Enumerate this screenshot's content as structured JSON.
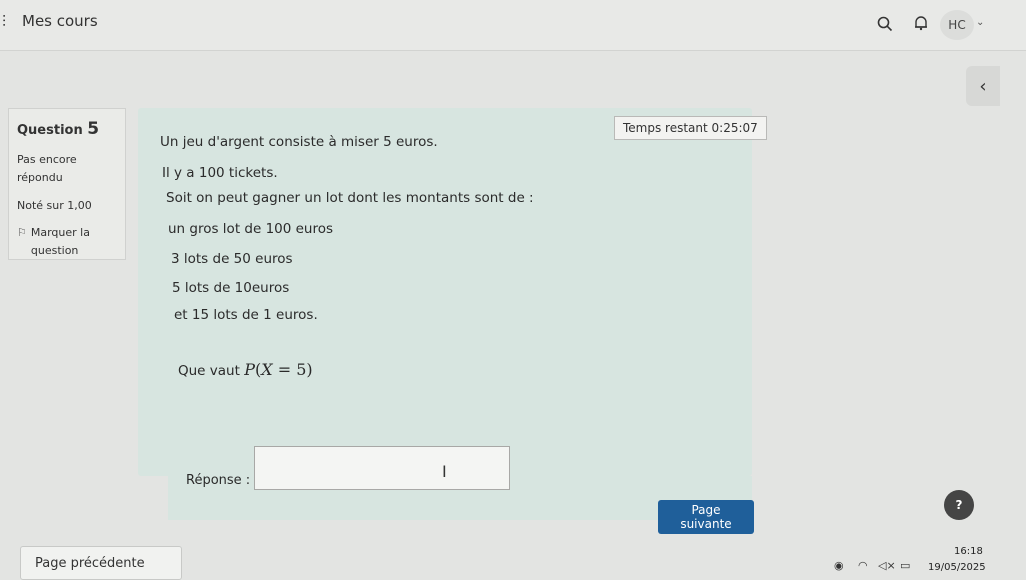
{
  "header": {
    "site_title": "Mes cours",
    "avatar_initials": "HC"
  },
  "question_info": {
    "label": "Question",
    "number": "5",
    "status": "Pas encore répondu",
    "grade": "Noté sur 1,00",
    "flag_label": "Marquer la question"
  },
  "timer": {
    "text": "Temps restant 0:25:07"
  },
  "question": {
    "lines": [
      "Un jeu d'argent consiste à miser 5 euros.",
      "Il y a 100 tickets.",
      "Soit on peut gagner un lot dont les montants sont de :",
      "un gros lot de 100 euros",
      "3 lots de 50 euros",
      "5 lots de 10euros",
      "et 15 lots de 1 euros."
    ],
    "prompt": "Que vaut",
    "math": {
      "fn": "P",
      "var": "X",
      "op": "=",
      "val": "5"
    },
    "answer_label": "Réponse :",
    "answer_value": ""
  },
  "nav": {
    "next_label": "Page suivante",
    "prev_label": "Page précédente",
    "help_label": "?"
  },
  "system": {
    "time": "16:18",
    "date": "19/05/2025"
  },
  "icons": {
    "menu": "menu-icon",
    "search": "search-icon",
    "bell": "bell-icon",
    "caret": "chevron-down-icon",
    "drawer": "chevron-left-icon",
    "flag": "flag-icon"
  },
  "colors": {
    "content_bg": "#d7e5e0",
    "primary_button": "#1f5f9a",
    "page_bg": "#e3e4e2"
  }
}
